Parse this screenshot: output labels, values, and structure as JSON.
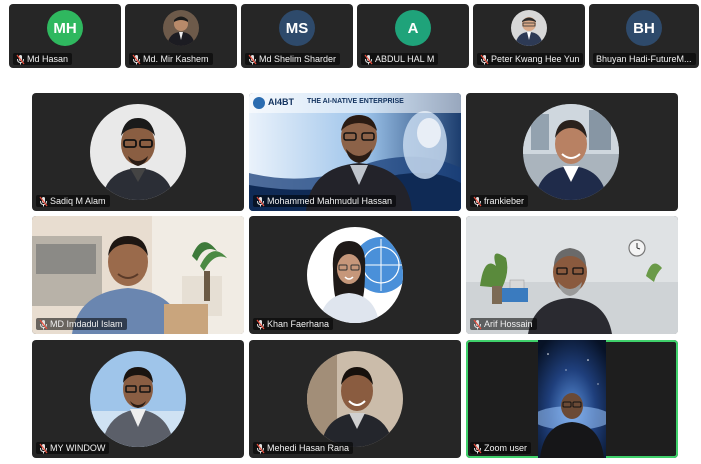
{
  "top_row": [
    {
      "name": "Md Hasan",
      "initials": "MH",
      "color": "#2fb85f",
      "type": "initials"
    },
    {
      "name": "Md. Mir Kashem",
      "type": "photo"
    },
    {
      "name": "Md Shelim Sharder",
      "initials": "MS",
      "color": "#2e4a6b",
      "type": "initials"
    },
    {
      "name": "ABDUL HAL M",
      "initials": "A",
      "color": "#1fa37a",
      "type": "initials"
    },
    {
      "name": "Peter Kwang Hee Yun",
      "type": "photo"
    },
    {
      "name": "Bhuyan Hadi-FutureM...",
      "initials": "BH",
      "color": "#2e4a6b",
      "type": "initials"
    }
  ],
  "grid": [
    {
      "name": "Sadiq M Alam"
    },
    {
      "name": "Mohammed Mahmudul Hassan",
      "banner_logo": "AI4BT",
      "banner_title": "THE AI-NATIVE ENTERPRISE"
    },
    {
      "name": "frankieber"
    },
    {
      "name": "MD Imdadul Islam"
    },
    {
      "name": "Khan Faerhana"
    },
    {
      "name": "Arif Hossain"
    },
    {
      "name": "MY WINDOW"
    },
    {
      "name": "Mehedi Hasan Rana"
    },
    {
      "name": "Zoom user"
    }
  ],
  "colors": {
    "active_speaker_border": "#3fd16b",
    "tile_bg": "#262626",
    "page_bg": "#ffffff"
  },
  "icons": {
    "mic_muted": "mic-muted-icon"
  }
}
